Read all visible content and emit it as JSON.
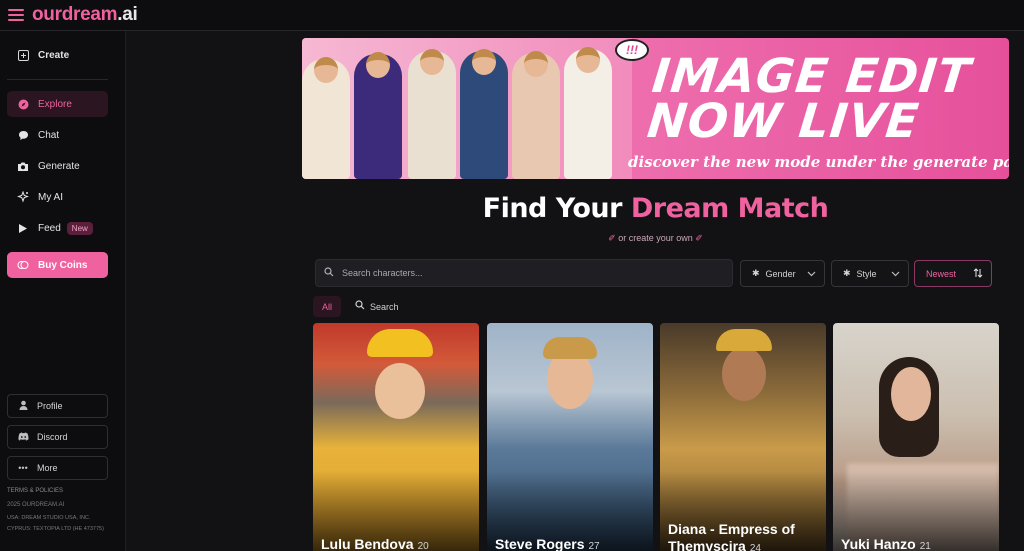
{
  "app": {
    "brand": "ourdream",
    "tld": ".ai"
  },
  "sidebar": {
    "create": "Create",
    "items": [
      {
        "label": "Explore",
        "active": true
      },
      {
        "label": "Chat"
      },
      {
        "label": "Generate"
      },
      {
        "label": "My AI"
      },
      {
        "label": "Feed",
        "badge": "New"
      }
    ],
    "buy_coins": "Buy Coins",
    "bottom_buttons": [
      "Profile",
      "Discord",
      "More"
    ],
    "footer": {
      "terms": "TERMS & POLICIES",
      "copyright": "2025 OURDREAM.AI",
      "line1": "USA: DREAM STUDIO USA, INC.",
      "line2": "CYPRUS: TEXTOPIA LTD (HE 473775)"
    }
  },
  "banner": {
    "title_line1": "IMAGE EDIT",
    "title_line2": "NOW LIVE",
    "subtitle": "discover the new mode under the generate page",
    "bubble": "!!!"
  },
  "heading": {
    "part1": "Find Your",
    "part2": "Dream Match"
  },
  "create_own": "or create your own",
  "search": {
    "placeholder": "Search characters..."
  },
  "filters": {
    "gender": "Gender",
    "style": "Style",
    "sort": "Newest"
  },
  "tabs": {
    "all": "All",
    "search": "Search"
  },
  "cards": [
    {
      "name": "Lulu Bendova",
      "age": "20"
    },
    {
      "name": "Steve Rogers",
      "age": "27"
    },
    {
      "name": "Diana - Empress of",
      "name2": "Themyscira",
      "age": "24"
    },
    {
      "name": "Yuki Hanzo",
      "age": "21"
    }
  ],
  "colors": {
    "accent": "#f0629f",
    "background": "#121214",
    "sidebar": "#0d0d0f"
  }
}
